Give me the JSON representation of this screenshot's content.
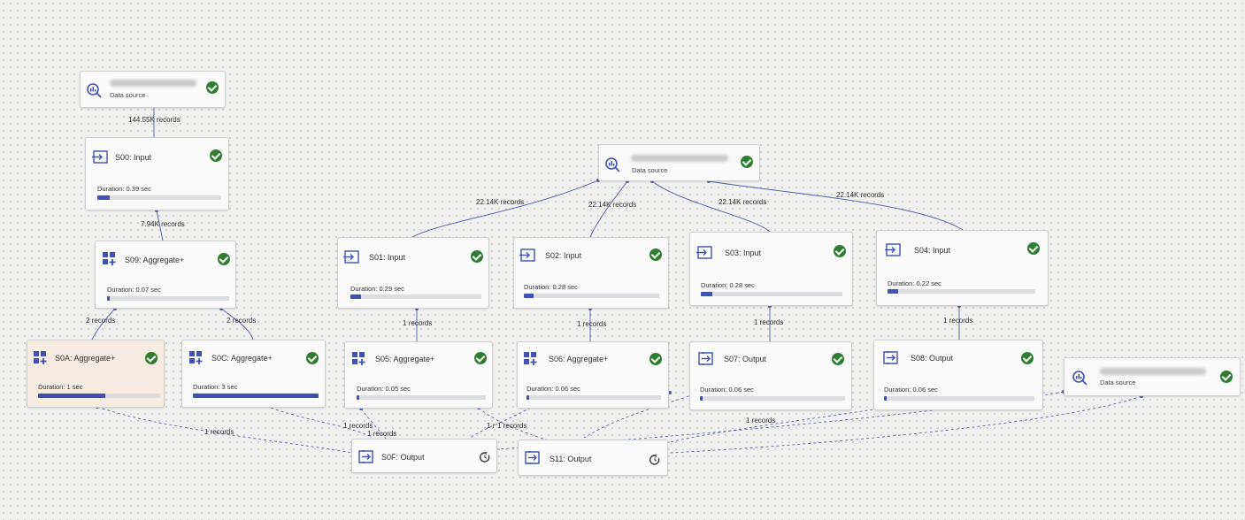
{
  "colors": {
    "accent": "#3f51b5",
    "success": "#2e7d32",
    "edge": "#4f5bb0"
  },
  "data_sources": {
    "ds1": {
      "label": "Data source"
    },
    "ds2": {
      "label": "Data source"
    },
    "ds3": {
      "label": "Data source"
    }
  },
  "nodes": {
    "s00": {
      "title": "S00: Input",
      "duration": "Duration: 0.39 sec",
      "progress": 0.1,
      "icon": "input-arrow-icon",
      "status": "success"
    },
    "s09": {
      "title": "S09: Aggregate+",
      "duration": "Duration: 0.07 sec",
      "progress": 0.02,
      "icon": "aggregate-plus-icon",
      "status": "success"
    },
    "s0a": {
      "title": "S0A: Aggregate+",
      "duration": "Duration: 1 sec",
      "progress": 0.55,
      "icon": "aggregate-plus-icon",
      "status": "success"
    },
    "s0c": {
      "title": "S0C: Aggregate+",
      "duration": "Duration: 3 sec",
      "progress": 1.0,
      "icon": "aggregate-plus-icon",
      "status": "success"
    },
    "s01": {
      "title": "S01: Input",
      "duration": "Duration: 0.29 sec",
      "progress": 0.08,
      "icon": "input-arrow-icon",
      "status": "success"
    },
    "s02": {
      "title": "S02: Input",
      "duration": "Duration: 0.28 sec",
      "progress": 0.07,
      "icon": "input-arrow-icon",
      "status": "success"
    },
    "s03": {
      "title": "S03: Input",
      "duration": "Duration: 0.28 sec",
      "progress": 0.08,
      "icon": "input-arrow-icon",
      "status": "success"
    },
    "s04": {
      "title": "S04: Input",
      "duration": "Duration: 0.22 sec",
      "progress": 0.07,
      "icon": "input-arrow-icon",
      "status": "success"
    },
    "s05": {
      "title": "S05: Aggregate+",
      "duration": "Duration: 0.05 sec",
      "progress": 0.02,
      "icon": "aggregate-plus-icon",
      "status": "success"
    },
    "s06": {
      "title": "S06: Aggregate+",
      "duration": "Duration: 0.06 sec",
      "progress": 0.02,
      "icon": "aggregate-plus-icon",
      "status": "success"
    },
    "s07": {
      "title": "S07: Output",
      "duration": "Duration: 0.06 sec",
      "progress": 0.02,
      "icon": "output-arrow-icon",
      "status": "success"
    },
    "s08": {
      "title": "S08: Output",
      "duration": "Duration: 0.06 sec",
      "progress": 0.02,
      "icon": "output-arrow-icon",
      "status": "success"
    },
    "s0f": {
      "title": "S0F: Output",
      "icon": "output-arrow-icon",
      "status": "pending"
    },
    "s11": {
      "title": "S11: Output",
      "icon": "output-arrow-icon",
      "status": "pending"
    }
  },
  "edge_labels": {
    "ds1_s00": "144.55K records",
    "s00_s09": "7.94K records",
    "s09_s0a": "2 records",
    "s09_s0c": "2 records",
    "ds2_s01": "22.14K records",
    "ds2_s02": "22.14K records",
    "ds2_s03": "22.14K records",
    "ds2_s04": "22.14K records",
    "s01_s05": "1 records",
    "s02_s06": "1 records",
    "s03_s07": "1 records",
    "s04_s08": "1 records",
    "s0a_s0f": "1 records",
    "s0c_s0f": "1 records",
    "s0c_s0f_2": "1 records",
    "s05_s11": "1 r",
    "s06_s11": "1 records",
    "s07_s11": "1 records"
  }
}
